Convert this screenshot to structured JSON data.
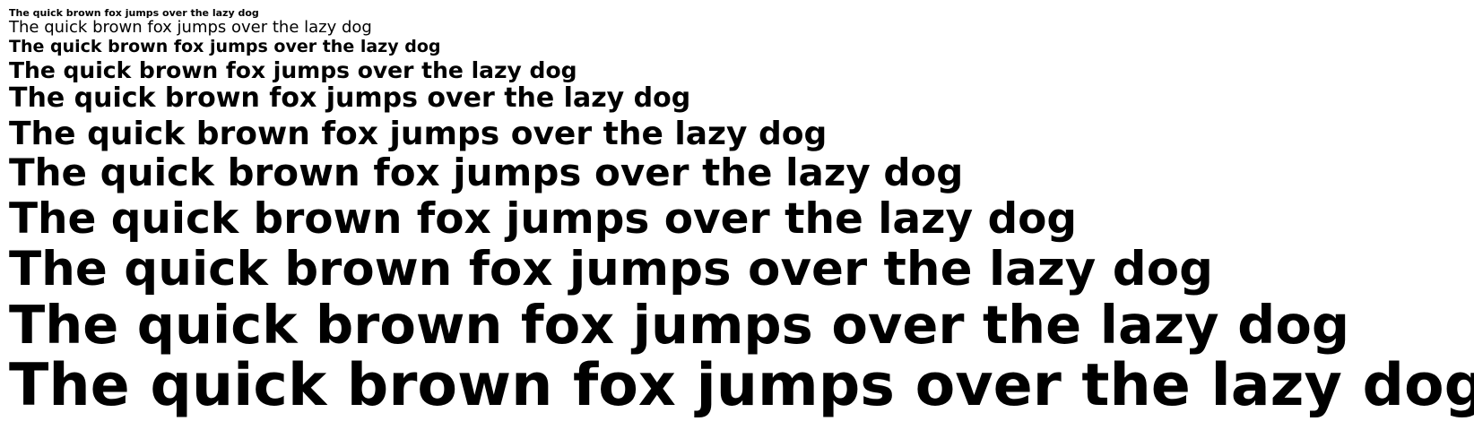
{
  "font_samples": [
    {
      "text": "The quick brown fox jumps over the lazy dog"
    },
    {
      "text": "The quick brown fox jumps over the lazy dog"
    },
    {
      "text": "The quick brown fox jumps over the lazy dog"
    },
    {
      "text": "The quick brown fox jumps over the lazy dog"
    },
    {
      "text": "The quick brown fox jumps over the lazy dog"
    },
    {
      "text": "The quick brown fox jumps over the lazy dog"
    },
    {
      "text": "The quick brown fox jumps over the lazy dog"
    },
    {
      "text": "The quick brown fox jumps over the lazy dog"
    },
    {
      "text": "The quick brown fox jumps over the lazy dog"
    },
    {
      "text": "The quick brown fox jumps over the lazy dog"
    },
    {
      "text": "The quick brown fox jumps over the lazy dog"
    }
  ],
  "colors": {
    "text": "#000000",
    "background": "#ffffff"
  }
}
